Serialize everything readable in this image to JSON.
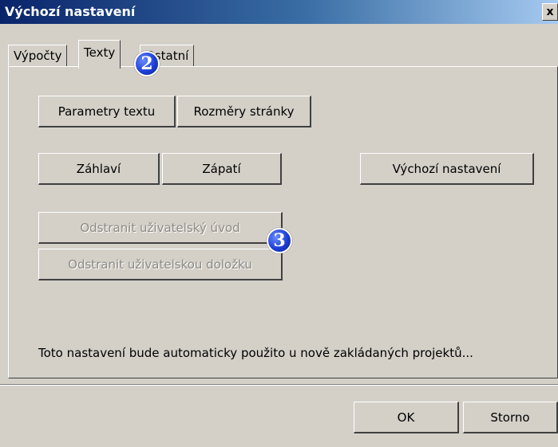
{
  "window": {
    "title": "Výchozí nastavení",
    "close_glyph": "x"
  },
  "tabs": [
    {
      "label": "Výpočty"
    },
    {
      "label": "Texty"
    },
    {
      "label": "Ostatní"
    }
  ],
  "buttons": {
    "text_params": "Parametry textu",
    "page_size": "Rozměry stránky",
    "header": "Záhlaví",
    "footer": "Zápatí",
    "defaults": "Výchozí nastavení",
    "remove_intro": "Odstranit uživatelský úvod",
    "remove_clause": "Odstranit uživatelskou doložku"
  },
  "info_text": "Toto nastavení bude automaticky použito u nově zakládaných projektů...",
  "dialog": {
    "ok": "OK",
    "cancel": "Storno"
  },
  "callouts": [
    "2",
    "3"
  ]
}
